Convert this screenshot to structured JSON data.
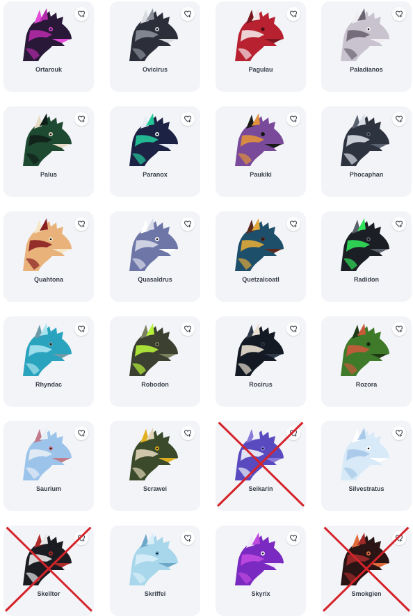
{
  "favorite_icon": "heart-plus-icon",
  "strike_color": "#d6232a",
  "dragons": [
    {
      "name": "Ortarouk",
      "crossed": false,
      "colors": [
        "#2a1838",
        "#b32aa8",
        "#e14bd8"
      ]
    },
    {
      "name": "Ovicirus",
      "crossed": false,
      "colors": [
        "#2c2f3a",
        "#8a8f9a",
        "#d9dbe0"
      ]
    },
    {
      "name": "Pagulau",
      "crossed": false,
      "colors": [
        "#b8212f",
        "#f2e6e8",
        "#7a1620"
      ]
    },
    {
      "name": "Paladianos",
      "crossed": false,
      "colors": [
        "#c9c3cf",
        "#6b6472",
        "#f0eef2"
      ]
    },
    {
      "name": "Palus",
      "crossed": false,
      "colors": [
        "#1f4a32",
        "#0f1f17",
        "#e6dcc6"
      ]
    },
    {
      "name": "Paranox",
      "crossed": false,
      "colors": [
        "#1c2244",
        "#23c79a",
        "#e8ecf5"
      ]
    },
    {
      "name": "Paukiki",
      "crossed": false,
      "colors": [
        "#7a4a9a",
        "#e0913a",
        "#1a1a1a"
      ]
    },
    {
      "name": "Phocaphan",
      "crossed": false,
      "colors": [
        "#2d3440",
        "#d8dde6",
        "#5a6270"
      ]
    },
    {
      "name": "Quahtona",
      "crossed": false,
      "colors": [
        "#e8b27a",
        "#8a1f22",
        "#f6e6c6"
      ]
    },
    {
      "name": "Quasaldrus",
      "crossed": false,
      "colors": [
        "#6e76a8",
        "#d7dbe8",
        "#ffffff"
      ]
    },
    {
      "name": "Quetzalcoatl",
      "crossed": false,
      "colors": [
        "#1e4f6a",
        "#e0a83a",
        "#5b2a1e"
      ]
    },
    {
      "name": "Radidon",
      "crossed": false,
      "colors": [
        "#1b1e24",
        "#31e05a",
        "#5a606a"
      ]
    },
    {
      "name": "Rhyndac",
      "crossed": false,
      "colors": [
        "#2aa3bf",
        "#a9e3f0",
        "#6c9aa8"
      ]
    },
    {
      "name": "Robodon",
      "crossed": false,
      "colors": [
        "#3b4030",
        "#b7f03a",
        "#7a8060"
      ]
    },
    {
      "name": "Rocirus",
      "crossed": false,
      "colors": [
        "#141a24",
        "#e8e0d0",
        "#2f3a4a"
      ]
    },
    {
      "name": "Rozora",
      "crossed": false,
      "colors": [
        "#3f7a2a",
        "#c85a3a",
        "#1f3a14"
      ]
    },
    {
      "name": "Saurium",
      "crossed": false,
      "colors": [
        "#9cc4ea",
        "#e8eef6",
        "#c07a8a"
      ]
    },
    {
      "name": "Scrawei",
      "crossed": false,
      "colors": [
        "#3a4a2a",
        "#e0d4b8",
        "#e0b020"
      ]
    },
    {
      "name": "Seikarin",
      "crossed": true,
      "colors": [
        "#5a4ac0",
        "#f0f2fa",
        "#8a7ad8"
      ]
    },
    {
      "name": "Silvestratus",
      "crossed": false,
      "colors": [
        "#d8eaf8",
        "#a7c8e8",
        "#ffffff"
      ]
    },
    {
      "name": "Skelltor",
      "crossed": true,
      "colors": [
        "#1a1c22",
        "#e8e8e8",
        "#b02a2a"
      ]
    },
    {
      "name": "Skriffei",
      "crossed": false,
      "colors": [
        "#a8d6ea",
        "#d8eef8",
        "#6ea8c8"
      ]
    },
    {
      "name": "Skyrix",
      "crossed": false,
      "colors": [
        "#7a2ac0",
        "#c04ae0",
        "#f0e8f8"
      ]
    },
    {
      "name": "Smokgien",
      "crossed": true,
      "colors": [
        "#2a1414",
        "#a02a2a",
        "#e06a3a"
      ]
    }
  ]
}
